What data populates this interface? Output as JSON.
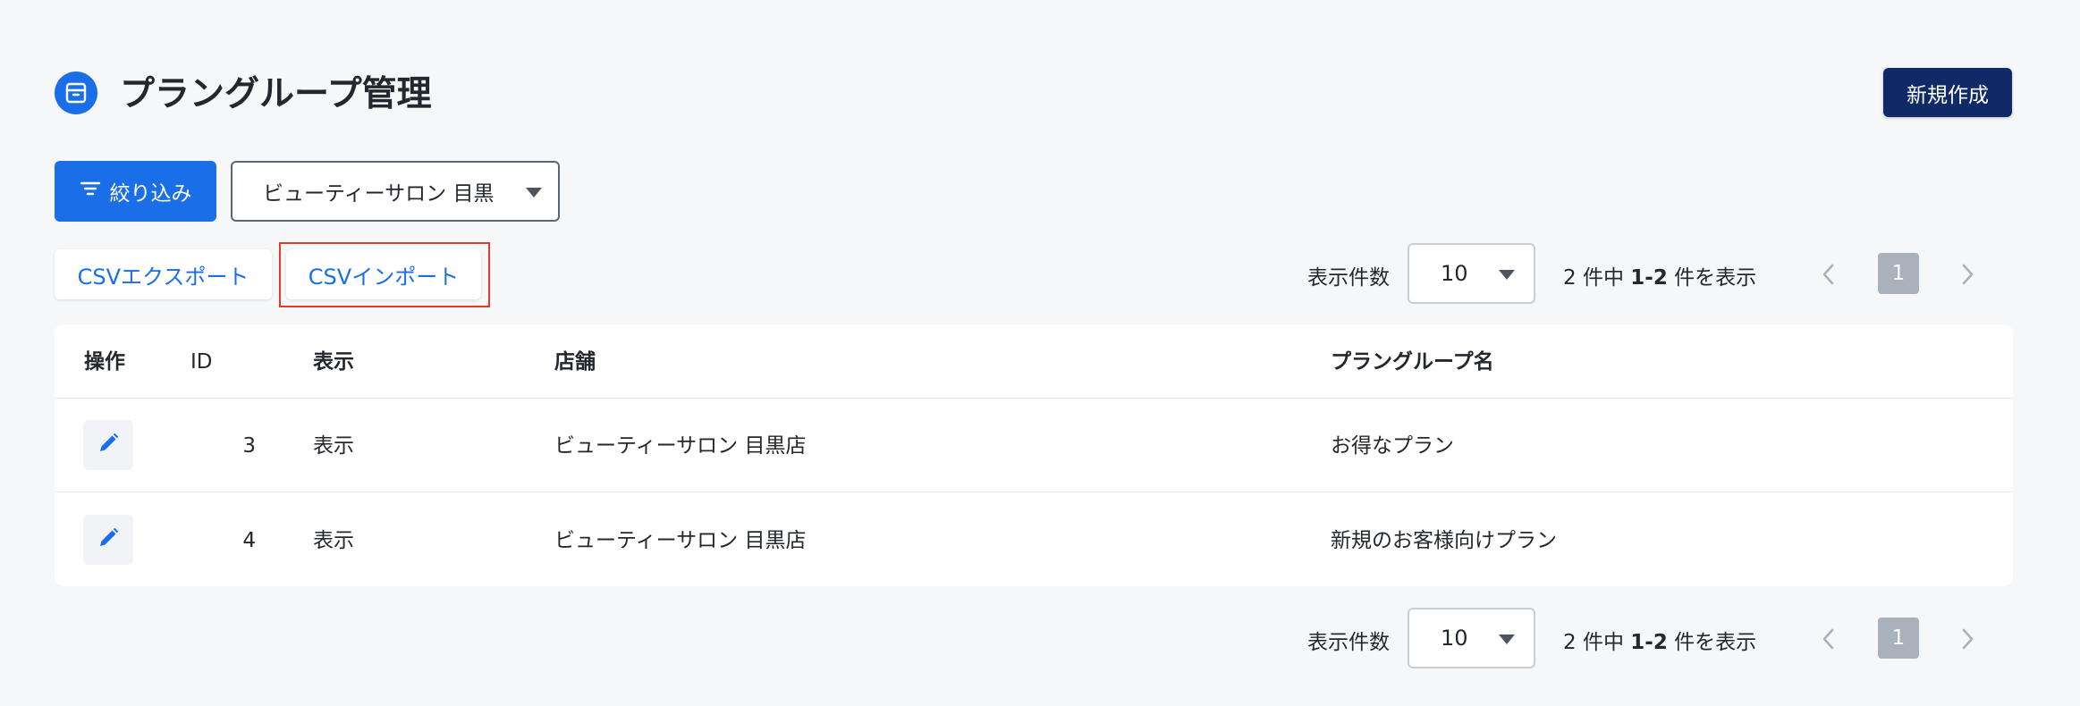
{
  "header": {
    "title": "プラングループ管理",
    "new_button": "新規作成"
  },
  "filters": {
    "filter_button": "絞り込み",
    "store_selected": "ビューティーサロン 目黒"
  },
  "csv": {
    "export_label": "CSVエクスポート",
    "import_label": "CSVインポート"
  },
  "pagination": {
    "per_page_label": "表示件数",
    "per_page_value": "10",
    "total": "2 件中",
    "range": "1-2",
    "range_suffix": "件を表示",
    "current_page": "1"
  },
  "table": {
    "columns": [
      "操作",
      "ID",
      "表示",
      "店舗",
      "プラングループ名"
    ],
    "rows": [
      {
        "id": "3",
        "visibility": "表示",
        "store": "ビューティーサロン 目黒店",
        "name": "お得なプラン"
      },
      {
        "id": "4",
        "visibility": "表示",
        "store": "ビューティーサロン 目黒店",
        "name": "新規のお客様向けプラン"
      }
    ]
  },
  "colors": {
    "primary": "#1a6fe8",
    "navy": "#0f2a66",
    "highlight": "#e63a25",
    "page_bg": "#f6f7f9"
  },
  "icons": [
    "archive-box-icon",
    "filter-lines-icon",
    "caret-down-icon",
    "chevron-left-icon",
    "chevron-right-icon",
    "pencil-icon"
  ]
}
